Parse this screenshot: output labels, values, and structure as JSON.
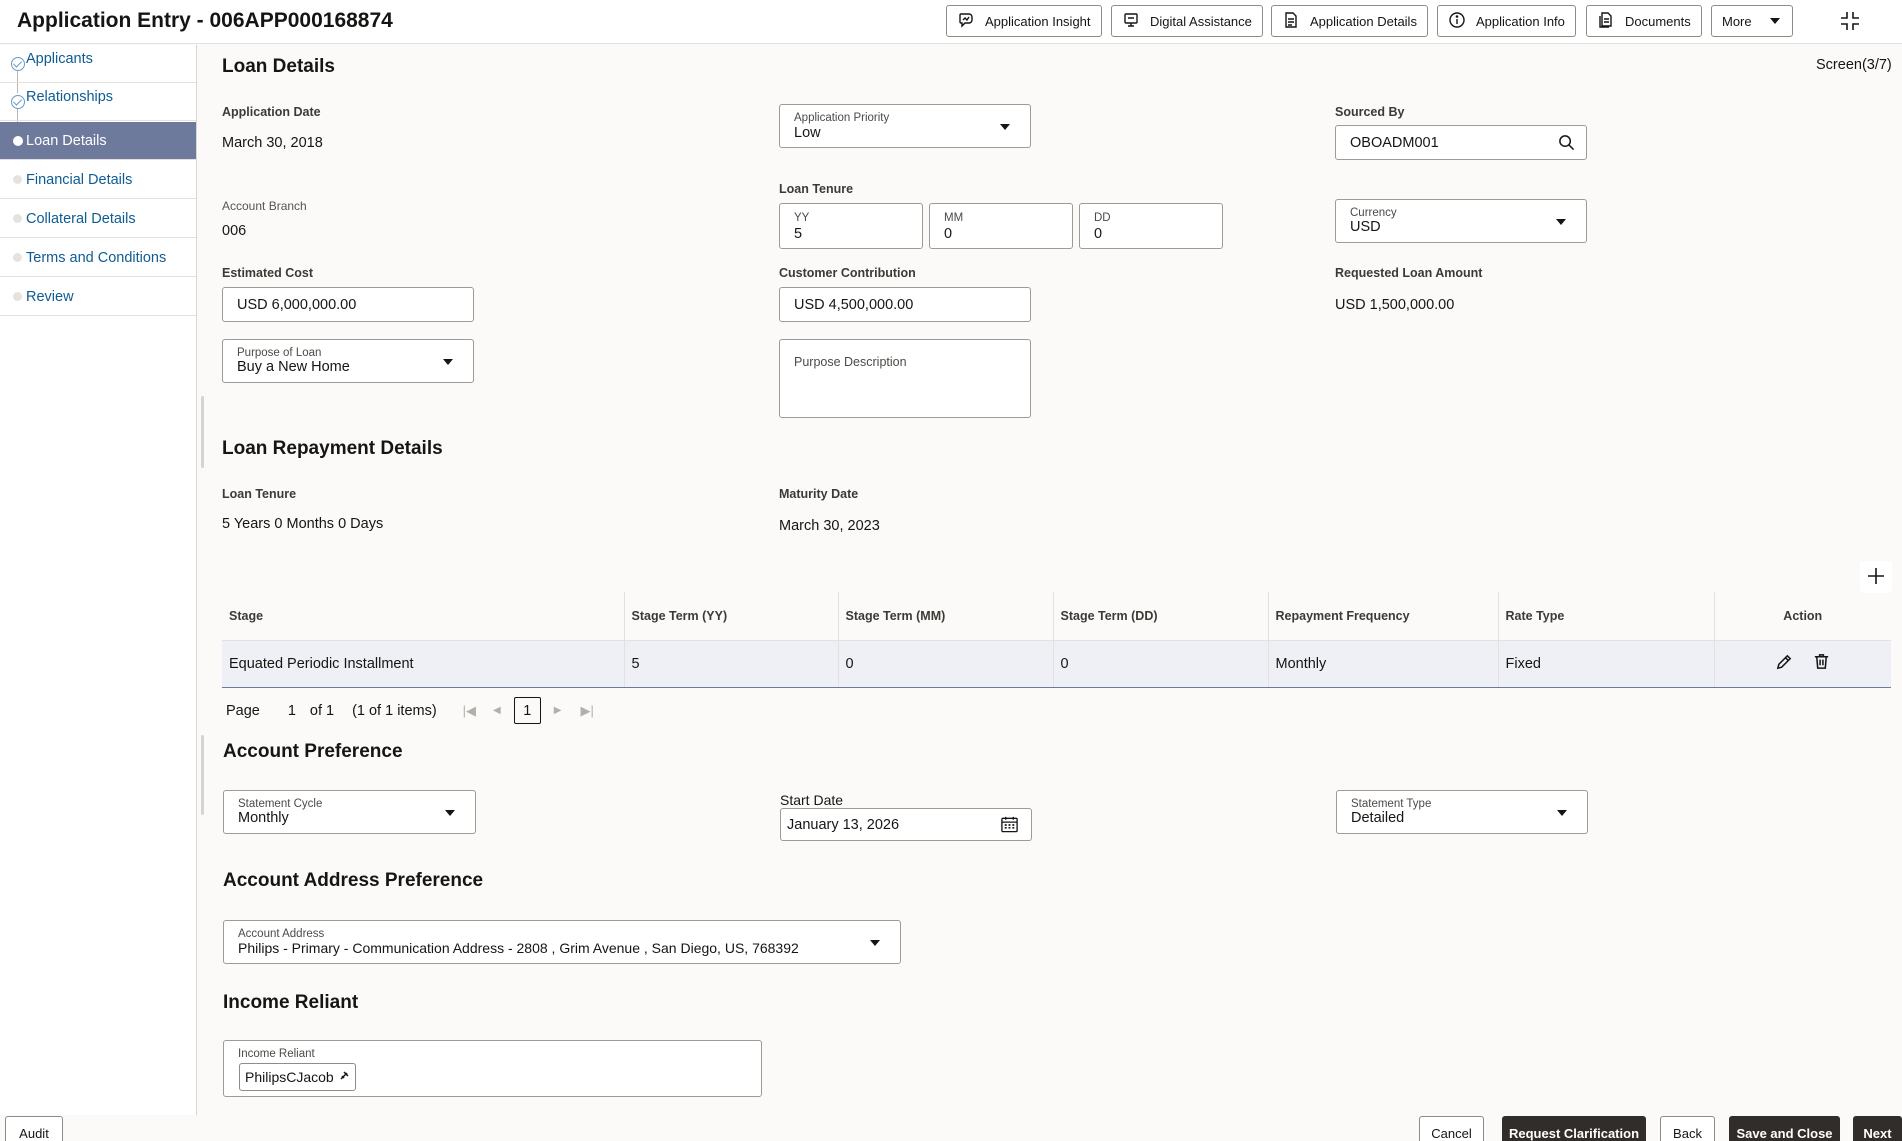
{
  "header": {
    "title": "Application Entry - 006APP000168874",
    "buttons": [
      {
        "label": "Application Insight",
        "icon": "insight-icon"
      },
      {
        "label": "Digital Assistance",
        "icon": "assistant-icon"
      },
      {
        "label": "Application Details",
        "icon": "document-icon"
      },
      {
        "label": "Application Info",
        "icon": "info-icon"
      },
      {
        "label": "Documents",
        "icon": "documents-icon"
      }
    ],
    "more_label": "More"
  },
  "sidebar": {
    "items": [
      {
        "label": "Applicants",
        "state": "done"
      },
      {
        "label": "Relationships",
        "state": "done"
      },
      {
        "label": "Loan Details",
        "state": "active"
      },
      {
        "label": "Financial Details",
        "state": "pending"
      },
      {
        "label": "Collateral Details",
        "state": "pending"
      },
      {
        "label": "Terms and Conditions",
        "state": "pending"
      },
      {
        "label": "Review",
        "state": "pending"
      }
    ]
  },
  "loan_details": {
    "title": "Loan Details",
    "screen_indicator": "Screen(3/7)",
    "application_date": {
      "label": "Application Date",
      "value": "March 30, 2018"
    },
    "application_priority": {
      "label": "Application Priority",
      "value": "Low"
    },
    "sourced_by": {
      "label": "Sourced By",
      "value": "OBOADM001"
    },
    "account_branch": {
      "label": "Account Branch",
      "value": "006"
    },
    "loan_tenure": {
      "label": "Loan Tenure",
      "yy": {
        "label": "YY",
        "value": "5"
      },
      "mm": {
        "label": "MM",
        "value": "0"
      },
      "dd": {
        "label": "DD",
        "value": "0"
      }
    },
    "currency": {
      "label": "Currency",
      "value": "USD"
    },
    "estimated_cost": {
      "label": "Estimated Cost",
      "value": "USD 6,000,000.00"
    },
    "customer_contribution": {
      "label": "Customer Contribution",
      "value": "USD 4,500,000.00"
    },
    "requested_loan_amount": {
      "label": "Requested Loan Amount",
      "value": "USD 1,500,000.00"
    },
    "purpose_of_loan": {
      "label": "Purpose of Loan",
      "value": "Buy a New Home"
    },
    "purpose_description": {
      "label": "Purpose Description",
      "value": ""
    }
  },
  "repayment": {
    "title": "Loan Repayment Details",
    "loan_tenure": {
      "label": "Loan Tenure",
      "value": "5 Years 0 Months 0 Days"
    },
    "maturity_date": {
      "label": "Maturity Date",
      "value": "March 30, 2023"
    },
    "table": {
      "columns": [
        "Stage",
        "Stage Term (YY)",
        "Stage Term (MM)",
        "Stage Term (DD)",
        "Repayment Frequency",
        "Rate Type",
        "Action"
      ],
      "rows": [
        [
          "Equated Periodic Installment",
          "5",
          "0",
          "0",
          "Monthly",
          "Fixed"
        ]
      ]
    },
    "pager": {
      "page_label": "Page",
      "page_value": "1",
      "of_label": "of 1",
      "items_label": "(1 of 1 items)",
      "current_page": "1"
    }
  },
  "account_preference": {
    "title": "Account Preference",
    "statement_cycle": {
      "label": "Statement Cycle",
      "value": "Monthly"
    },
    "start_date": {
      "label": "Start Date",
      "value": "January 13, 2026"
    },
    "statement_type": {
      "label": "Statement Type",
      "value": "Detailed"
    }
  },
  "account_address": {
    "title": "Account Address Preference",
    "field": {
      "label": "Account Address",
      "value": "Philips - Primary - Communication Address - 2808 , Grim Avenue , San Diego, US, 768392"
    }
  },
  "income_reliant": {
    "title": "Income Reliant",
    "field": {
      "label": "Income Reliant",
      "chip": "PhilipsCJacob"
    }
  },
  "footer": {
    "audit": "Audit",
    "cancel": "Cancel",
    "request_clarification": "Request Clarification",
    "back": "Back",
    "save_close": "Save and Close",
    "next": "Next"
  },
  "colors": {
    "active_nav": "#6e7a9c",
    "link": "#0e5c92",
    "primary_button": "#312d2a"
  }
}
